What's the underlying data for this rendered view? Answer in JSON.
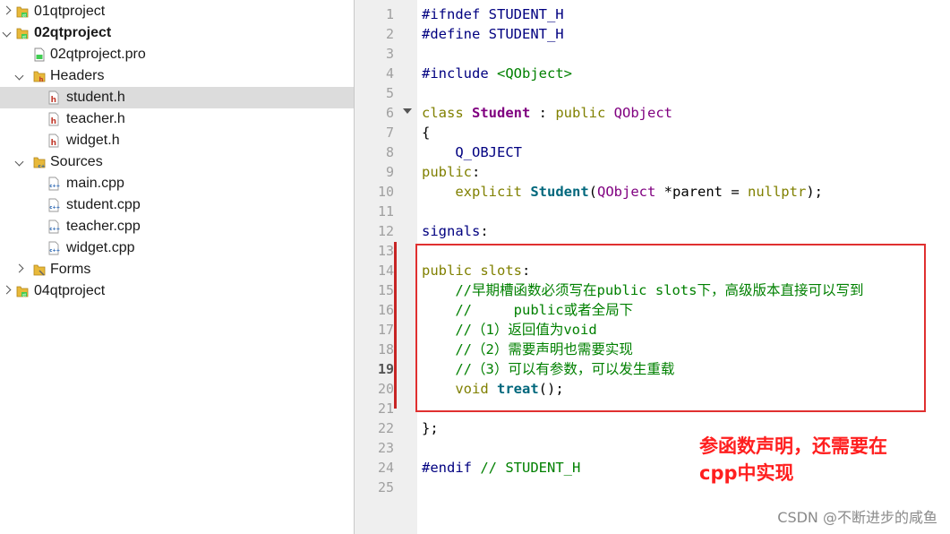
{
  "project_tree": {
    "items": [
      {
        "label": "01qtproject",
        "icon": "qt-project-folder-icon",
        "expanded": false
      },
      {
        "label": "02qtproject",
        "icon": "qt-project-folder-icon",
        "expanded": true
      },
      {
        "label": "02qtproject.pro",
        "icon": "pro-file-icon"
      },
      {
        "label": "Headers",
        "icon": "headers-folder-icon",
        "expanded": true
      },
      {
        "label": "student.h",
        "icon": "header-file-icon",
        "selected": true
      },
      {
        "label": "teacher.h",
        "icon": "header-file-icon"
      },
      {
        "label": "widget.h",
        "icon": "header-file-icon"
      },
      {
        "label": "Sources",
        "icon": "sources-folder-icon",
        "expanded": true
      },
      {
        "label": "main.cpp",
        "icon": "cpp-file-icon"
      },
      {
        "label": "student.cpp",
        "icon": "cpp-file-icon"
      },
      {
        "label": "teacher.cpp",
        "icon": "cpp-file-icon"
      },
      {
        "label": "widget.cpp",
        "icon": "cpp-file-icon"
      },
      {
        "label": "Forms",
        "icon": "forms-folder-icon",
        "expanded": false
      },
      {
        "label": "04qtproject",
        "icon": "qt-project-folder-icon",
        "expanded": false
      }
    ]
  },
  "editor": {
    "current_line": 19,
    "line_numbers": [
      "1",
      "2",
      "3",
      "4",
      "5",
      "6",
      "7",
      "8",
      "9",
      "10",
      "11",
      "12",
      "13",
      "14",
      "15",
      "16",
      "17",
      "18",
      "19",
      "20",
      "21",
      "22",
      "23",
      "24",
      "25"
    ],
    "lines": [
      [
        {
          "t": "#ifndef STUDENT_H",
          "c": "pp"
        }
      ],
      [
        {
          "t": "#define STUDENT_H",
          "c": "pp"
        }
      ],
      [],
      [
        {
          "t": "#include ",
          "c": "pp"
        },
        {
          "t": "<QObject>",
          "c": "str"
        }
      ],
      [],
      [
        {
          "t": "class ",
          "c": "kw"
        },
        {
          "t": "Student",
          "c": "cls"
        },
        {
          "t": " : ",
          "c": ""
        },
        {
          "t": "public ",
          "c": "kw"
        },
        {
          "t": "QObject",
          "c": "typ"
        }
      ],
      [
        {
          "t": "{",
          "c": ""
        }
      ],
      [
        {
          "t": "    ",
          "c": ""
        },
        {
          "t": "Q_OBJECT",
          "c": "mac"
        }
      ],
      [
        {
          "t": "public",
          "c": "kw"
        },
        {
          "t": ":",
          "c": ""
        }
      ],
      [
        {
          "t": "    ",
          "c": ""
        },
        {
          "t": "explicit ",
          "c": "kw"
        },
        {
          "t": "Student",
          "c": "fn"
        },
        {
          "t": "(",
          "c": ""
        },
        {
          "t": "QObject",
          "c": "typ"
        },
        {
          "t": " *parent = ",
          "c": ""
        },
        {
          "t": "nullptr",
          "c": "kw"
        },
        {
          "t": ");",
          "c": ""
        }
      ],
      [],
      [
        {
          "t": "signals",
          "c": "sig"
        },
        {
          "t": ":",
          "c": ""
        }
      ],
      [],
      [
        {
          "t": "public ",
          "c": "kw"
        },
        {
          "t": "slots",
          "c": "kw"
        },
        {
          "t": ":",
          "c": ""
        }
      ],
      [
        {
          "t": "    //早期槽函数必须写在public slots下，高级版本直接可以写到",
          "c": "cm"
        }
      ],
      [
        {
          "t": "    //     public或者全局下",
          "c": "cm"
        }
      ],
      [
        {
          "t": "    //（1）返回值为void",
          "c": "cm"
        }
      ],
      [
        {
          "t": "    //（2）需要声明也需要实现",
          "c": "cm"
        }
      ],
      [
        {
          "t": "    //（3）可以有参数，可以发生重载",
          "c": "cm"
        }
      ],
      [
        {
          "t": "    ",
          "c": ""
        },
        {
          "t": "void ",
          "c": "kw"
        },
        {
          "t": "treat",
          "c": "fn"
        },
        {
          "t": "();",
          "c": ""
        }
      ],
      [],
      [
        {
          "t": "};",
          "c": ""
        }
      ],
      [],
      [
        {
          "t": "#endif ",
          "c": "pp"
        },
        {
          "t": "// STUDENT_H",
          "c": "cm"
        }
      ],
      []
    ]
  },
  "annotation": {
    "line1": "参函数声明，还需要在",
    "line2": "cpp中实现"
  },
  "watermark": "CSDN @不断进步的咸鱼",
  "colors": {
    "keyword": "#808000",
    "preprocessor": "#000080",
    "comment": "#008000",
    "class_name": "#800080",
    "annotation_red": "#ff1f1f"
  }
}
